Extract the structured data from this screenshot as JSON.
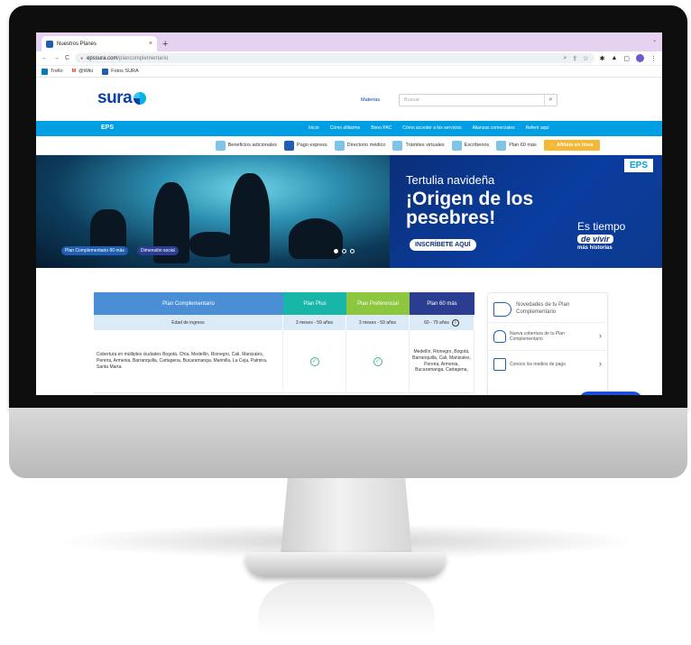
{
  "browser": {
    "tab_title": "Nuestros Planes",
    "tab_close": "×",
    "new_tab": "+",
    "url_domain": "epssura.com",
    "url_path": "/plancomplementario",
    "bookmarks": [
      "Trello",
      "@Wiki",
      "Fotos SURA"
    ]
  },
  "site": {
    "logo": "sura",
    "header_link": "Materias",
    "search_placeholder": "Buscar",
    "nav_title": "EPS",
    "nav_links": [
      "Inicio",
      "Cómo afiliarme",
      "Bono PAC",
      "Cómo acceder a los servicios",
      "Alianzas comerciales",
      "Referir aquí"
    ],
    "quick_links": [
      "Beneficios adicionales",
      "Pago express",
      "Directorio médico",
      "Trámites virtuales",
      "Escríbenos",
      "Plan 60 más"
    ],
    "affiliate_button": "Afíliate en línea"
  },
  "hero": {
    "eps_badge": "EPS",
    "tertulia": "Tertulia navideña",
    "headline": "¡Origen de los pesebres!",
    "cta": "INSCRÍBETE AQUÍ",
    "es_tiempo": "Es tiempo",
    "de_vivir": "de vivir",
    "mas_historias": "más historias",
    "pill_plan": "Plan Complementario 60 más",
    "pill_dimension": "Dimensión social"
  },
  "table": {
    "headers": [
      "Plan Complementario",
      "Plan Plus",
      "Plan Preferencial",
      "Plan 60 más"
    ],
    "sub_row": [
      "Edad de ingreso",
      "3 meses - 59 años",
      "3 meses - 59 años",
      "60 - 79 años"
    ],
    "coverage_text": "Cobertura en múltiples ciudades Bogotá, Chía, Medellín, Rionegro, Cali, Manizales, Pereira, Armenia, Barranquilla, Cartagena, Bucaramanga, Marinilla, La Ceja, Palmira, Santa Marta.",
    "plan60_cities": "Medellín, Rionegro, Bogotá, Barranquilla, Cali, Manizales, Pereira, Armenia, Bucaramanga, Cartagena,",
    "check": "✓",
    "info": "i"
  },
  "side": {
    "title": "Novedades de tu Plan Complementario",
    "item1": "Nueva cobertura de tu Plan Complementario",
    "item2": "Conoce los medios de pago",
    "arrow": "›"
  },
  "colors": {
    "sura_blue": "#0c3fa5",
    "nav_blue": "#009fe3",
    "header_comp": "#4a8fd6",
    "header_plus": "#17b6a9",
    "header_pref": "#8dc63f",
    "header_60": "#2a3d91",
    "affiliate_yellow": "#f5b834"
  }
}
